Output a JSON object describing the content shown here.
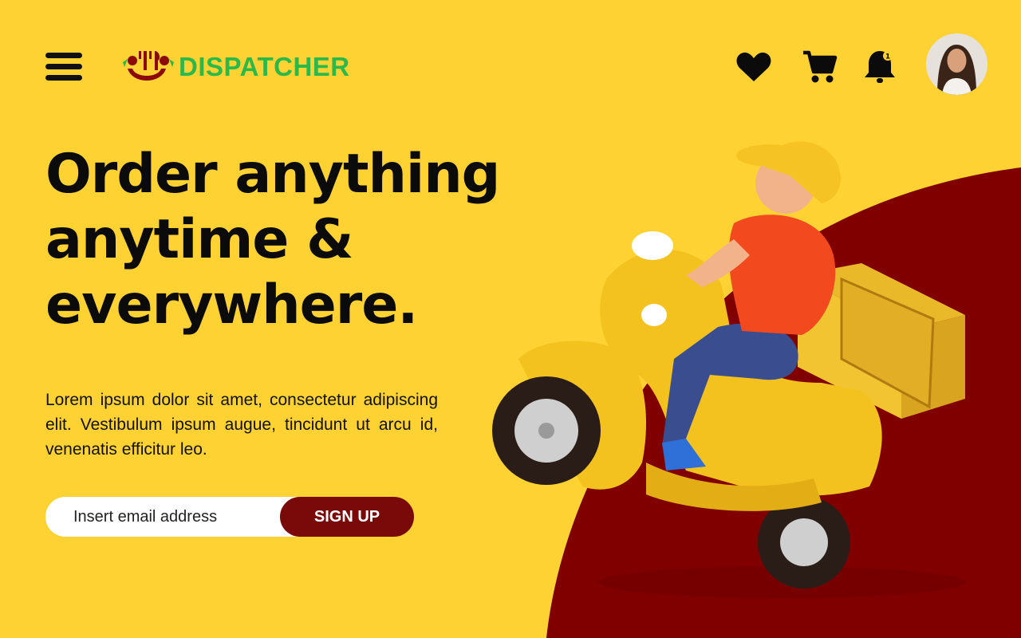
{
  "brand": {
    "name": "DISPATCHER",
    "text_color": "#2BB94A",
    "mark_color": "#8B0A0A"
  },
  "header": {
    "icons": [
      "menu-icon",
      "heart-icon",
      "cart-icon",
      "bell-icon"
    ],
    "notification_count": "1",
    "avatar": "user-avatar"
  },
  "hero": {
    "title_lines": [
      "Order anything",
      "anytime &",
      "everywhere."
    ],
    "body": "Lorem ipsum dolor sit amet, consectetur adipiscing elit. Vestibulum ipsum augue, tincidunt ut arcu id, venenatis efficitur leo."
  },
  "signup": {
    "placeholder": "Insert email address",
    "button_label": "SIGN UP"
  },
  "colors": {
    "background": "#FFD233",
    "accent": "#7A0A0A",
    "text": "#0b0b0b"
  }
}
